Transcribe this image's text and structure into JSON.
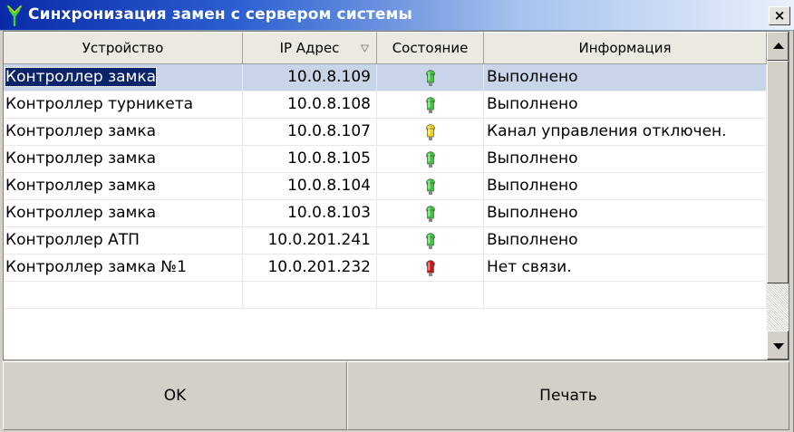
{
  "window": {
    "title": "Синхронизация замен с сервером системы",
    "close_label": "×"
  },
  "table": {
    "columns": [
      "Устройство",
      "IP Адрес",
      "Состояние",
      "Информация"
    ],
    "rows": [
      {
        "device": "Контроллер замка",
        "ip": "10.0.8.109",
        "status": "green",
        "info": "Выполнено",
        "selected": true
      },
      {
        "device": "Контроллер турникета",
        "ip": "10.0.8.108",
        "status": "green",
        "info": "Выполнено"
      },
      {
        "device": "Контроллер замка",
        "ip": "10.0.8.107",
        "status": "yellow",
        "info": "Канал управления отключен."
      },
      {
        "device": "Контроллер замка",
        "ip": "10.0.8.105",
        "status": "green",
        "info": "Выполнено"
      },
      {
        "device": "Контроллер замка",
        "ip": "10.0.8.104",
        "status": "green",
        "info": "Выполнено"
      },
      {
        "device": "Контроллер замка",
        "ip": "10.0.8.103",
        "status": "green",
        "info": "Выполнено"
      },
      {
        "device": "Контроллер АТП",
        "ip": "10.0.201.241",
        "status": "green",
        "info": "Выполнено"
      },
      {
        "device": "Контроллер замка №1",
        "ip": "10.0.201.232",
        "status": "red",
        "info": "Нет связи."
      }
    ]
  },
  "status_colors": {
    "green": "#3cc83c",
    "yellow": "#f2d21e",
    "red": "#d01414"
  },
  "buttons": {
    "ok": "OK",
    "print": "Печать"
  }
}
